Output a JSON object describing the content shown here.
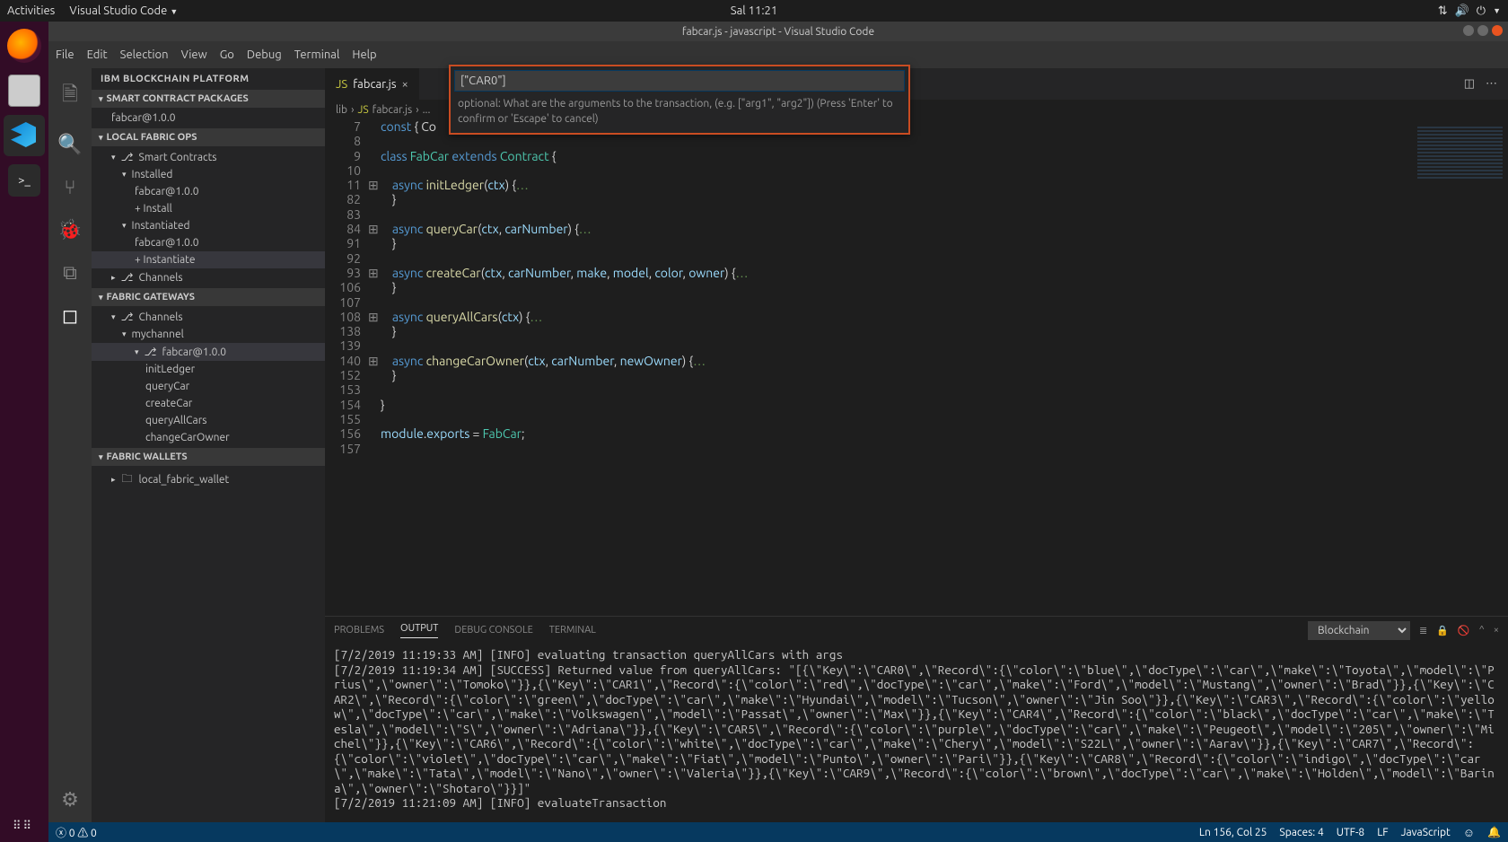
{
  "gnome": {
    "activities": "Activities",
    "app": "Visual Studio Code",
    "clock": "Sal 11:21"
  },
  "window_title": "fabcar.js - javascript - Visual Studio Code",
  "menu": [
    "File",
    "Edit",
    "Selection",
    "View",
    "Go",
    "Debug",
    "Terminal",
    "Help"
  ],
  "sidebar": {
    "title": "IBM BLOCKCHAIN PLATFORM",
    "sections": {
      "packages": {
        "title": "SMART CONTRACT PACKAGES",
        "items": [
          "fabcar@1.0.0"
        ]
      },
      "localfabric": {
        "title": "LOCAL FABRIC OPS",
        "tree": [
          {
            "label": "Smart Contracts",
            "icon": "branch",
            "chev": "▾"
          },
          {
            "label": "Installed",
            "indent": 1,
            "chev": "▾"
          },
          {
            "label": "fabcar@1.0.0",
            "indent": 2
          },
          {
            "label": "+ Install",
            "indent": 2
          },
          {
            "label": "Instantiated",
            "indent": 1,
            "chev": "▾"
          },
          {
            "label": "fabcar@1.0.0",
            "indent": 2
          },
          {
            "label": "+ Instantiate",
            "indent": 2,
            "sel": true
          },
          {
            "label": "Channels",
            "icon": "branch",
            "chev": "▸"
          }
        ]
      },
      "gateways": {
        "title": "FABRIC GATEWAYS",
        "tree": [
          {
            "label": "Channels",
            "icon": "branch",
            "chev": "▾"
          },
          {
            "label": "mychannel",
            "indent": 1,
            "chev": "▾"
          },
          {
            "label": "fabcar@1.0.0",
            "icon": "branch",
            "indent": 2,
            "chev": "▾",
            "sel": true
          },
          {
            "label": "initLedger",
            "indent": 3
          },
          {
            "label": "queryCar",
            "indent": 3
          },
          {
            "label": "createCar",
            "indent": 3
          },
          {
            "label": "queryAllCars",
            "indent": 3
          },
          {
            "label": "changeCarOwner",
            "indent": 3
          }
        ]
      },
      "wallets": {
        "title": "FABRIC WALLETS",
        "tree": [
          {
            "label": "local_fabric_wallet",
            "icon": "folder",
            "chev": "▸"
          }
        ]
      }
    }
  },
  "tab": {
    "label": "fabcar.js",
    "close": "×"
  },
  "breadcrumb": [
    "lib",
    "fabcar.js",
    "..."
  ],
  "quick_input": {
    "value": "[\"CAR0\"]",
    "hint": "optional: What are the arguments to the transaction, (e.g. [\"arg1\", \"arg2\"]) (Press 'Enter' to confirm or 'Escape' to cancel)"
  },
  "editor": {
    "lines": [
      {
        "n": "7",
        "fold": "",
        "html": "<span class='k'>const</span> <span class='pn'>{ Co</span>"
      },
      {
        "n": "8",
        "fold": "",
        "html": ""
      },
      {
        "n": "9",
        "fold": "",
        "html": "<span class='k'>class</span> <span class='cls'>FabCar</span> <span class='k'>extends</span> <span class='cls'>Contract</span> <span class='pn'>{</span>"
      },
      {
        "n": "10",
        "fold": "",
        "html": ""
      },
      {
        "n": "11",
        "fold": "⊞",
        "html": "    <span class='k'>async</span> <span class='fn'>initLedger</span><span class='pn'>(</span><span class='pr'>ctx</span><span class='pn'>) {</span><span class='cm'>…</span>"
      },
      {
        "n": "82",
        "fold": "",
        "html": "    <span class='pn'>}</span>"
      },
      {
        "n": "83",
        "fold": "",
        "html": ""
      },
      {
        "n": "84",
        "fold": "⊞",
        "html": "    <span class='k'>async</span> <span class='fn'>queryCar</span><span class='pn'>(</span><span class='pr'>ctx</span><span class='pn'>, </span><span class='pr'>carNumber</span><span class='pn'>) {</span><span class='cm'>…</span>"
      },
      {
        "n": "91",
        "fold": "",
        "html": "    <span class='pn'>}</span>"
      },
      {
        "n": "92",
        "fold": "",
        "html": ""
      },
      {
        "n": "93",
        "fold": "⊞",
        "html": "    <span class='k'>async</span> <span class='fn'>createCar</span><span class='pn'>(</span><span class='pr'>ctx</span><span class='pn'>, </span><span class='pr'>carNumber</span><span class='pn'>, </span><span class='pr'>make</span><span class='pn'>, </span><span class='pr'>model</span><span class='pn'>, </span><span class='pr'>color</span><span class='pn'>, </span><span class='pr'>owner</span><span class='pn'>) {</span><span class='cm'>…</span>"
      },
      {
        "n": "106",
        "fold": "",
        "html": "    <span class='pn'>}</span>"
      },
      {
        "n": "107",
        "fold": "",
        "html": ""
      },
      {
        "n": "108",
        "fold": "⊞",
        "html": "    <span class='k'>async</span> <span class='fn'>queryAllCars</span><span class='pn'>(</span><span class='pr'>ctx</span><span class='pn'>) {</span><span class='cm'>…</span>"
      },
      {
        "n": "138",
        "fold": "",
        "html": "    <span class='pn'>}</span>"
      },
      {
        "n": "139",
        "fold": "",
        "html": ""
      },
      {
        "n": "140",
        "fold": "⊞",
        "html": "    <span class='k'>async</span> <span class='fn'>changeCarOwner</span><span class='pn'>(</span><span class='pr'>ctx</span><span class='pn'>, </span><span class='pr'>carNumber</span><span class='pn'>, </span><span class='pr'>newOwner</span><span class='pn'>) {</span><span class='cm'>…</span>"
      },
      {
        "n": "152",
        "fold": "",
        "html": "    <span class='pn'>}</span>"
      },
      {
        "n": "153",
        "fold": "",
        "html": ""
      },
      {
        "n": "154",
        "fold": "",
        "html": "<span class='pn'>}</span>"
      },
      {
        "n": "155",
        "fold": "",
        "html": ""
      },
      {
        "n": "156",
        "fold": "",
        "html": "<span class='pr'>module</span><span class='pn'>.</span><span class='pr'>exports</span> <span class='pn'>=</span> <span class='cls'>FabCar</span><span class='pn'>;</span>"
      },
      {
        "n": "157",
        "fold": "",
        "html": ""
      }
    ]
  },
  "panel": {
    "tabs": [
      "PROBLEMS",
      "OUTPUT",
      "DEBUG CONSOLE",
      "TERMINAL"
    ],
    "active": 1,
    "channel": "Blockchain",
    "output": "[7/2/2019 11:19:33 AM] [INFO] evaluating transaction queryAllCars with args\n[7/2/2019 11:19:34 AM] [SUCCESS] Returned value from queryAllCars: \"[{\\\"Key\\\":\\\"CAR0\\\",\\\"Record\\\":{\\\"color\\\":\\\"blue\\\",\\\"docType\\\":\\\"car\\\",\\\"make\\\":\\\"Toyota\\\",\\\"model\\\":\\\"Prius\\\",\\\"owner\\\":\\\"Tomoko\\\"}},{\\\"Key\\\":\\\"CAR1\\\",\\\"Record\\\":{\\\"color\\\":\\\"red\\\",\\\"docType\\\":\\\"car\\\",\\\"make\\\":\\\"Ford\\\",\\\"model\\\":\\\"Mustang\\\",\\\"owner\\\":\\\"Brad\\\"}},{\\\"Key\\\":\\\"CAR2\\\",\\\"Record\\\":{\\\"color\\\":\\\"green\\\",\\\"docType\\\":\\\"car\\\",\\\"make\\\":\\\"Hyundai\\\",\\\"model\\\":\\\"Tucson\\\",\\\"owner\\\":\\\"Jin Soo\\\"}},{\\\"Key\\\":\\\"CAR3\\\",\\\"Record\\\":{\\\"color\\\":\\\"yellow\\\",\\\"docType\\\":\\\"car\\\",\\\"make\\\":\\\"Volkswagen\\\",\\\"model\\\":\\\"Passat\\\",\\\"owner\\\":\\\"Max\\\"}},{\\\"Key\\\":\\\"CAR4\\\",\\\"Record\\\":{\\\"color\\\":\\\"black\\\",\\\"docType\\\":\\\"car\\\",\\\"make\\\":\\\"Tesla\\\",\\\"model\\\":\\\"S\\\",\\\"owner\\\":\\\"Adriana\\\"}},{\\\"Key\\\":\\\"CAR5\\\",\\\"Record\\\":{\\\"color\\\":\\\"purple\\\",\\\"docType\\\":\\\"car\\\",\\\"make\\\":\\\"Peugeot\\\",\\\"model\\\":\\\"205\\\",\\\"owner\\\":\\\"Michel\\\"}},{\\\"Key\\\":\\\"CAR6\\\",\\\"Record\\\":{\\\"color\\\":\\\"white\\\",\\\"docType\\\":\\\"car\\\",\\\"make\\\":\\\"Chery\\\",\\\"model\\\":\\\"S22L\\\",\\\"owner\\\":\\\"Aarav\\\"}},{\\\"Key\\\":\\\"CAR7\\\",\\\"Record\\\":{\\\"color\\\":\\\"violet\\\",\\\"docType\\\":\\\"car\\\",\\\"make\\\":\\\"Fiat\\\",\\\"model\\\":\\\"Punto\\\",\\\"owner\\\":\\\"Pari\\\"}},{\\\"Key\\\":\\\"CAR8\\\",\\\"Record\\\":{\\\"color\\\":\\\"indigo\\\",\\\"docType\\\":\\\"car\\\",\\\"make\\\":\\\"Tata\\\",\\\"model\\\":\\\"Nano\\\",\\\"owner\\\":\\\"Valeria\\\"}},{\\\"Key\\\":\\\"CAR9\\\",\\\"Record\\\":{\\\"color\\\":\\\"brown\\\",\\\"docType\\\":\\\"car\\\",\\\"make\\\":\\\"Holden\\\",\\\"model\\\":\\\"Barina\\\",\\\"owner\\\":\\\"Shotaro\\\"}}]\"\n[7/2/2019 11:21:09 AM] [INFO] evaluateTransaction"
  },
  "status": {
    "errors": "0",
    "warnings": "0",
    "pos": "Ln 156, Col 25",
    "spaces": "Spaces: 4",
    "enc": "UTF-8",
    "eol": "LF",
    "lang": "JavaScript"
  }
}
